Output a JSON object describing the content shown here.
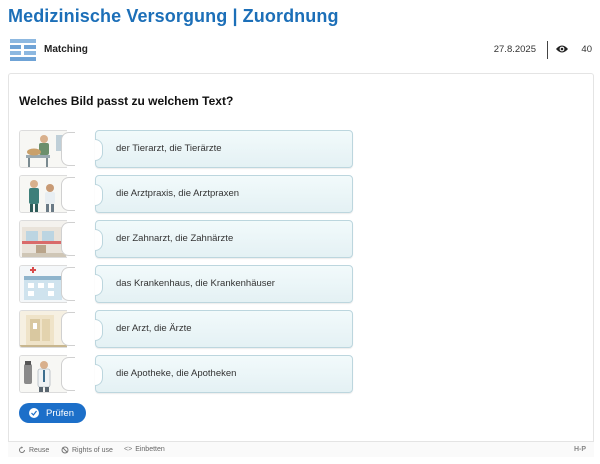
{
  "page": {
    "title": "Medizinische Versorgung | Zuordnung"
  },
  "meta": {
    "type_label": "Matching",
    "date": "27.8.2025",
    "views": "40",
    "type_icon": "matching-icon",
    "views_icon": "eye-icon"
  },
  "task": {
    "question": "Welches Bild passt zu welchem Text?",
    "items": [
      {
        "image": "veterinarian-image",
        "label": "der Tierarzt, die Tierärzte"
      },
      {
        "image": "doctors-office-image",
        "label": "die Arztpraxis, die Arztpraxen"
      },
      {
        "image": "dentist-image",
        "label": "der Zahnarzt, die Zahnärzte"
      },
      {
        "image": "hospital-image",
        "label": "das Krankenhaus, die Krankenhäuser"
      },
      {
        "image": "doctor-image",
        "label": "der Arzt, die Ärzte"
      },
      {
        "image": "pharmacy-image",
        "label": "die Apotheke, die Apotheken"
      }
    ],
    "check_button": "Prüfen"
  },
  "footer": {
    "reuse": "Reuse",
    "rights": "Rights of use",
    "embed": "Einbetten",
    "brand": "H-P"
  },
  "colors": {
    "title": "#1c6fb8",
    "button": "#1c6fc9",
    "card_border": "#bcd6de"
  }
}
